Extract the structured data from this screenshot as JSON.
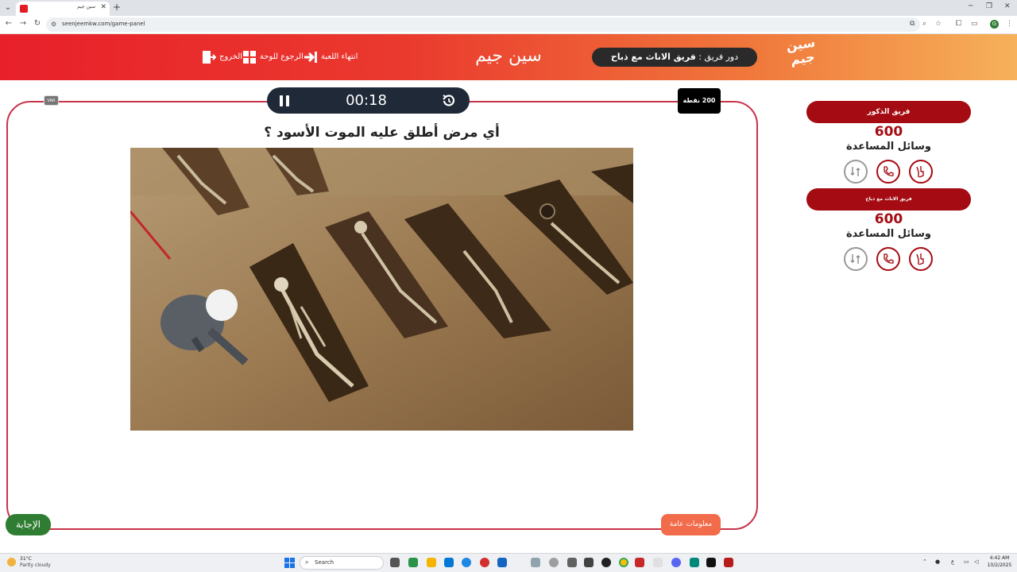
{
  "browser": {
    "tab_title": "سين جيم",
    "url": "seenjeemkw.com/game-panel"
  },
  "header": {
    "logo_text_line1": "سين",
    "logo_text_line2": "جيم",
    "turn_label": "دور فريق : ",
    "turn_team": "فريق الاناث مع ذباح",
    "game_name": "سين جيم",
    "end_game_label": "انتهاء اللعبة",
    "back_to_board_label": "الرجوع للوحة",
    "exit_label": "الخروج"
  },
  "game": {
    "var_label": "VAR",
    "timer": "00:18",
    "points": "200 نقطة",
    "question": "أي مرض أطلق عليه الموت الأسود ؟",
    "answer_label": "الإجابة",
    "category_label": "معلومات عامة"
  },
  "teams": [
    {
      "name": "فريق الذكور",
      "score": "600",
      "aids_label": "وسائل المساعدة"
    },
    {
      "name": "فريق الاناث مع ذباح",
      "score": "600",
      "aids_label": "وسائل المساعدة"
    }
  ],
  "taskbar": {
    "weather_temp": "31°C",
    "weather_desc": "Partly cloudy",
    "search_placeholder": "Search",
    "time": "4:42 AM",
    "date": "10/2/2025",
    "lang": "ع"
  },
  "colors": {
    "brand_red": "#e8202a",
    "team_red": "#a50b12",
    "panel_border": "#c8334a",
    "answer_green": "#2e7d32",
    "category_orange": "#f26b4a"
  }
}
